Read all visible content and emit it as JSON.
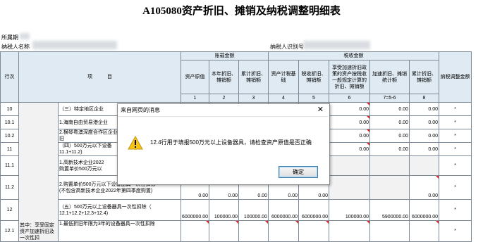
{
  "report": {
    "title": "A105080资产折旧、摊销及纳税调整明细表",
    "org_label": "所属期",
    "taxpayer_name_label": "纳税人名称",
    "taxpayer_id_label": "纳税人识别号"
  },
  "table": {
    "col_row_label": "行次",
    "col_item_label": "项　　　目",
    "group_account": "账载金额",
    "group_tax": "税收金额",
    "col_headers": [
      "资产原值",
      "本年折旧、摊销额",
      "累计折旧、摊销额",
      "资产计税基础",
      "税收折旧、摊销额",
      "享受加速折旧政策的资产按税收一般规定计算的折旧、摊销额",
      "加速折旧、摊销统计额",
      "累计折旧、摊销额",
      "纳税调整金额"
    ],
    "col_numbers": [
      "1",
      "2",
      "3",
      "4",
      "5",
      "6",
      "7=5-6",
      "8",
      "9(2-5)"
    ],
    "side_label": "其中：享受固定资产加速折旧及一次性扣",
    "rows": [
      {
        "no": "10",
        "item": "（三）特定地区企业",
        "c6": "0.00",
        "c7": "0.00",
        "c8": "0.00",
        "c9": "*"
      },
      {
        "no": "10.1",
        "item": "1.海南自由贸易港企业",
        "c6": "0.00",
        "c7": "0.00",
        "c8": "0.00",
        "c9": "*"
      },
      {
        "no": "10.2",
        "item": "2.横琴粤澳深度合作区企业",
        "item2": "旧",
        "c6": "0.00",
        "c7": "0.00",
        "c8": "0.00",
        "c9": "*"
      },
      {
        "no": "11",
        "item": "（四）500万元以下设备",
        "item2": "11.1+11.2)",
        "c6": "0.00",
        "c7": "0.00",
        "c8": "0.00",
        "c9": "*"
      },
      {
        "no": "11.1",
        "item": "1.高新技术企业2022",
        "item2": "购置单价500万元以",
        "c9": "*"
      },
      {
        "no": "11.2",
        "item": "2.购置单价500万元以下设备器具一次性扣除",
        "item2": "(不包含高新技术企业2022年第四季度购置)",
        "c1": "0.00",
        "c2": "0.00",
        "c3": "0.00",
        "c4": "0.00",
        "c5": "0.00",
        "c8": "0.00",
        "c9": "*"
      },
      {
        "no": "12",
        "item": "（五）500万元以上设备器具一次性扣除（",
        "item2": "12.1+12.2+12.3+12.4)",
        "c1": "6000000.00",
        "c2": "100000.00",
        "c3": "100000.00",
        "c4": "6000000.00",
        "c5": "6000000.00",
        "c6": "100000.00",
        "c7": "5900000.00",
        "c8": "6000000.00",
        "c9": "*"
      },
      {
        "no": "12.1",
        "item": "1.最低折旧年限为3年的设备器具一次性扣除",
        "c9": "*"
      }
    ]
  },
  "dialog": {
    "title": "来自网页的消息",
    "close_glyph": "✕",
    "message": "12.4行用于填报500万元以上设备器具，请检查资产原值是否正确",
    "ok_label": "确定",
    "icon": "warning-icon"
  }
}
